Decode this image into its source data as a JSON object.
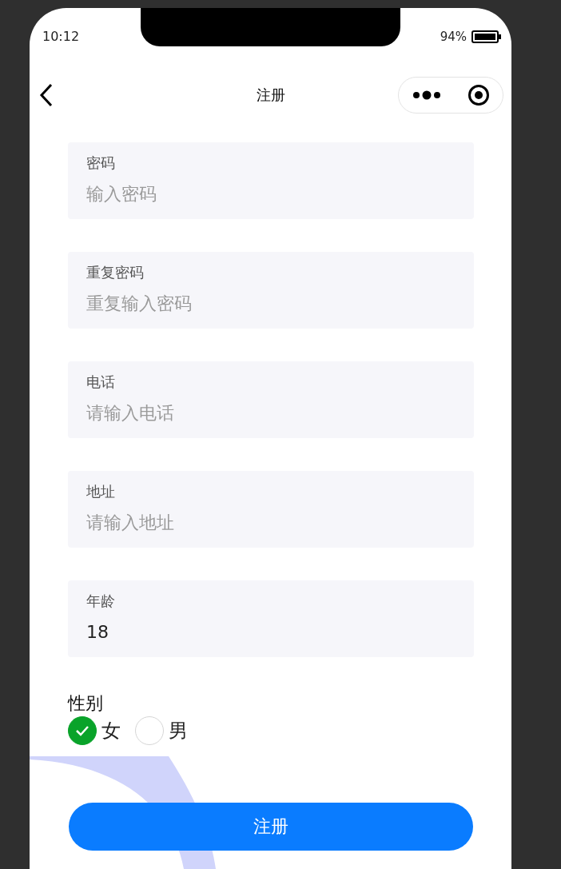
{
  "status_bar": {
    "time": "10:12",
    "battery": "94%"
  },
  "nav": {
    "title": "注册"
  },
  "fields": [
    {
      "label": "密码",
      "placeholder": "输入密码"
    },
    {
      "label": "重复密码",
      "placeholder": "重复输入密码"
    },
    {
      "label": "电话",
      "placeholder": "请输入电话"
    },
    {
      "label": "地址",
      "placeholder": "请输入地址"
    },
    {
      "label": "年龄",
      "value": "18"
    }
  ],
  "gender": {
    "label": "性别",
    "options": [
      {
        "label": "女",
        "selected": true
      },
      {
        "label": "男",
        "selected": false
      }
    ]
  },
  "submit_button": "注册"
}
